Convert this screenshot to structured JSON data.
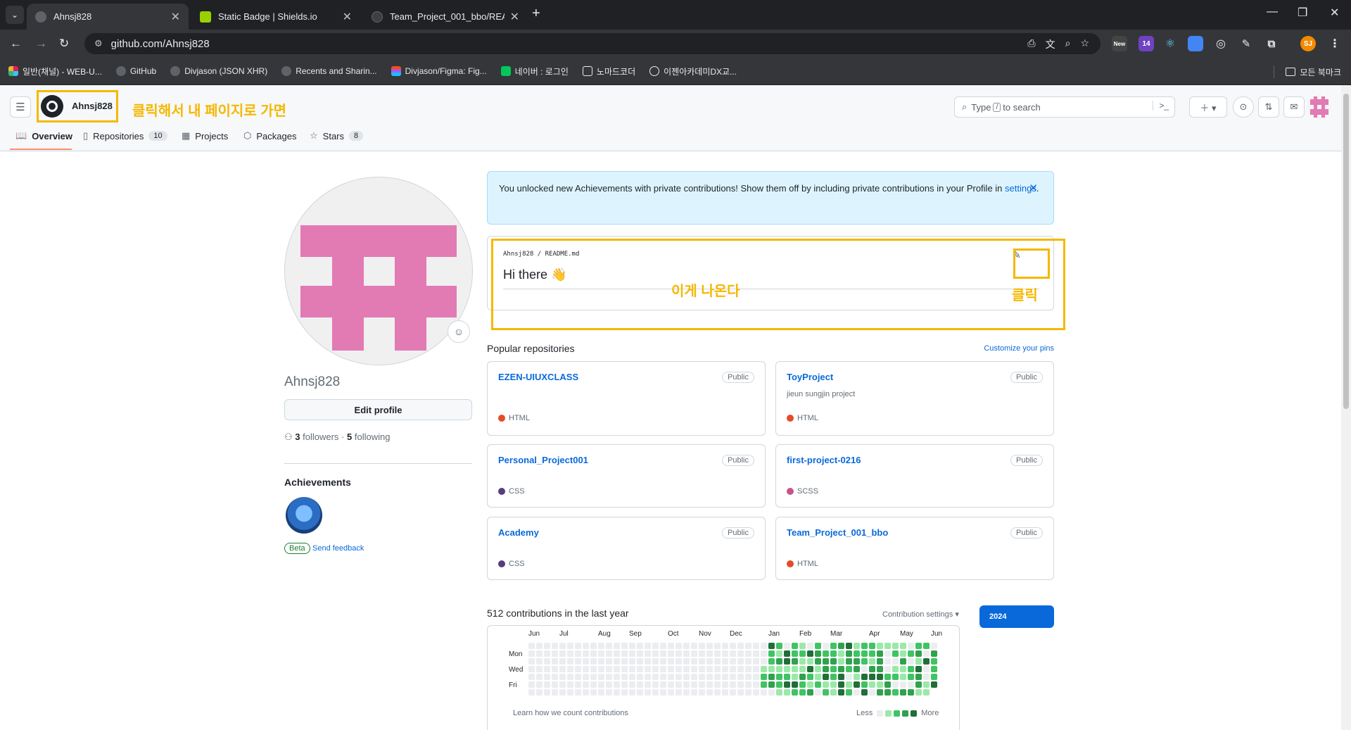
{
  "browser": {
    "tabs": [
      {
        "title": "Ahnsj828",
        "active": true
      },
      {
        "title": "Static Badge | Shields.io",
        "active": false
      },
      {
        "title": "Team_Project_001_bbo/READM",
        "active": false
      }
    ],
    "url": "github.com/Ahnsj828",
    "ext_badge": "14",
    "ext_new": "New",
    "profile_initials": "SJ",
    "bookmarks": [
      "일반(채널) - WEB-U...",
      "GitHub",
      "Divjason (JSON XHR)",
      "Recents and Sharin...",
      "Divjason/Figma: Fig...",
      "네이버 : 로그인",
      "노마드코더",
      "이젠아카데미DX교..."
    ],
    "bookmarks_all": "모든 북마크"
  },
  "header": {
    "username": "Ahnsj828",
    "search_text_before": "Type",
    "search_key": "/",
    "search_text_after": "to search",
    "nav": [
      {
        "label": "Overview",
        "count": null
      },
      {
        "label": "Repositories",
        "count": "10"
      },
      {
        "label": "Projects",
        "count": null
      },
      {
        "label": "Packages",
        "count": null
      },
      {
        "label": "Stars",
        "count": "8"
      }
    ]
  },
  "annotations": {
    "top": "클릭해서 내 페이지로 가면",
    "readme": "이게 나온다",
    "pencil": "클릭"
  },
  "profile": {
    "username": "Ahnsj828",
    "edit_button": "Edit profile",
    "followers_count": "3",
    "followers_label": "followers",
    "following_count": "5",
    "following_label": "following",
    "achievements_title": "Achievements",
    "beta": "Beta",
    "feedback": "Send feedback"
  },
  "flash": {
    "text": "You unlocked new Achievements with private contributions! Show them off by including private contributions in your Profile in",
    "link": "settings",
    "end": "."
  },
  "readme": {
    "owner": "Ahnsj828",
    "file": "README.md",
    "heading": "Hi there 👋"
  },
  "popular": {
    "title": "Popular repositories",
    "customize": "Customize your pins",
    "repos": [
      {
        "name": "EZEN-UIUXCLASS",
        "visibility": "Public",
        "description": "",
        "language": "HTML",
        "lang_color": "#e34c26"
      },
      {
        "name": "ToyProject",
        "visibility": "Public",
        "description": "jieun sungjin project",
        "language": "HTML",
        "lang_color": "#e34c26"
      },
      {
        "name": "Personal_Project001",
        "visibility": "Public",
        "description": "",
        "language": "CSS",
        "lang_color": "#563d7c"
      },
      {
        "name": "first-project-0216",
        "visibility": "Public",
        "description": "",
        "language": "SCSS",
        "lang_color": "#c6538c"
      },
      {
        "name": "Academy",
        "visibility": "Public",
        "description": "",
        "language": "CSS",
        "lang_color": "#563d7c"
      },
      {
        "name": "Team_Project_001_bbo",
        "visibility": "Public",
        "description": "",
        "language": "HTML",
        "lang_color": "#e34c26"
      }
    ]
  },
  "contributions": {
    "title": "512 contributions in the last year",
    "settings": "Contribution settings ▾",
    "year": "2024",
    "months": [
      "Jun",
      "Jul",
      "Aug",
      "Sep",
      "Oct",
      "Nov",
      "Dec",
      "Jan",
      "Feb",
      "Mar",
      "Apr",
      "May",
      "Jun"
    ],
    "days": [
      "Mon",
      "Wed",
      "Fri"
    ],
    "learn": "Learn how we count contributions",
    "less": "Less",
    "more": "More",
    "colors": [
      "#ebedf0",
      "#9be9a8",
      "#40c463",
      "#30a14e",
      "#216e39"
    ]
  }
}
